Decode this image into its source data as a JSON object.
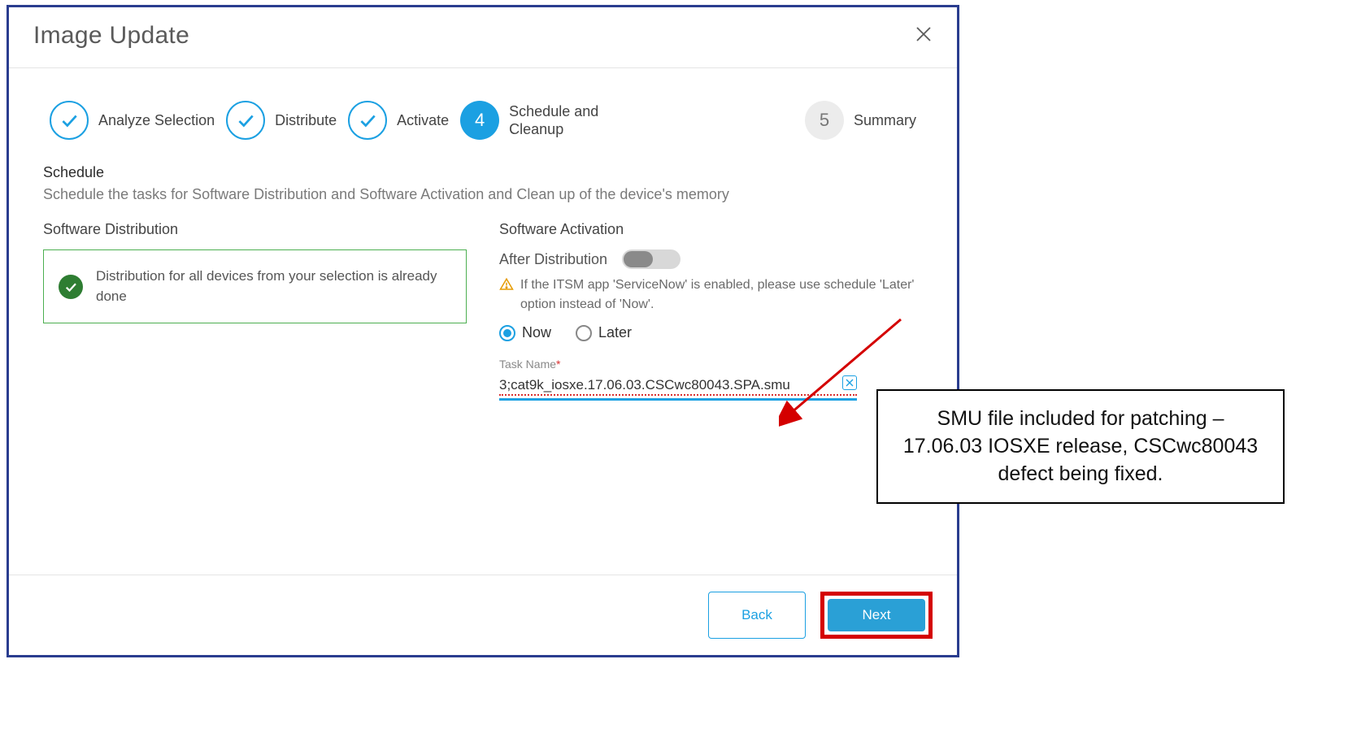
{
  "modal": {
    "title": "Image Update"
  },
  "stepper": {
    "steps": [
      {
        "label": "Analyze Selection",
        "state": "done"
      },
      {
        "label": "Distribute",
        "state": "done"
      },
      {
        "label": "Activate",
        "state": "done"
      },
      {
        "num": "4",
        "label": "Schedule and Cleanup",
        "state": "active"
      },
      {
        "num": "5",
        "label": "Summary",
        "state": "future"
      }
    ]
  },
  "schedule": {
    "heading": "Schedule",
    "desc": "Schedule the tasks for Software Distribution and Software Activation and Clean up of the device's memory"
  },
  "distribution": {
    "heading": "Software Distribution",
    "done_msg": "Distribution for all devices from your selection is already done"
  },
  "activation": {
    "heading": "Software Activation",
    "after_label": "After Distribution",
    "toggle_on": false,
    "warning": "If the ITSM app 'ServiceNow' is enabled, please use schedule 'Later' option instead of 'Now'.",
    "radio": {
      "now": "Now",
      "later": "Later",
      "selected": "now"
    },
    "task_label": "Task Name",
    "task_value": "3;cat9k_iosxe.17.06.03.CSCwc80043.SPA.smu"
  },
  "footer": {
    "back": "Back",
    "next": "Next"
  },
  "annotation": {
    "text": "SMU file included for patching – 17.06.03 IOSXE release, CSCwc80043 defect being fixed."
  }
}
